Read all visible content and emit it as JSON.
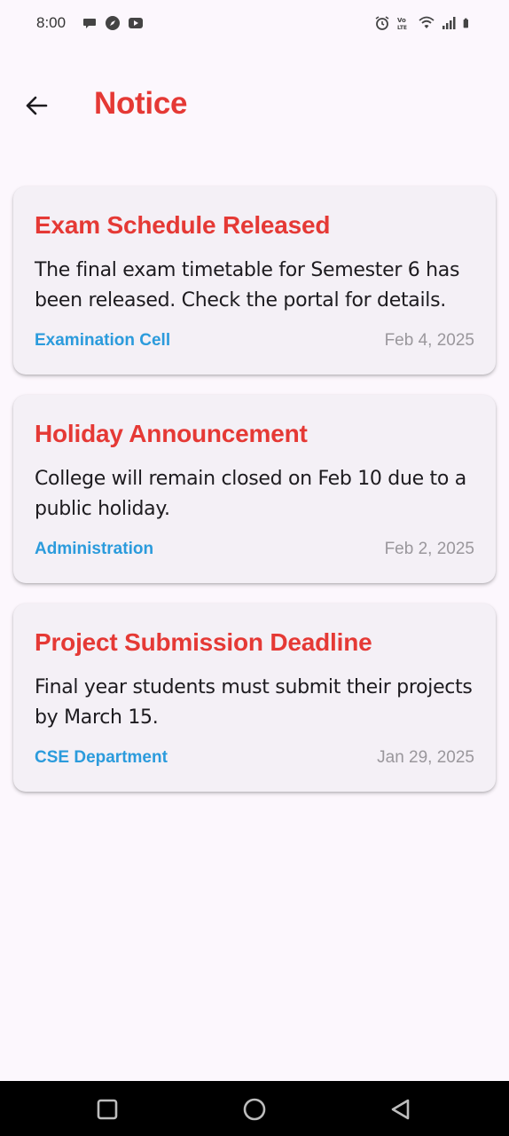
{
  "status_bar": {
    "time": "8:00",
    "left_icons": [
      "chat-bubble-icon",
      "compass-icon",
      "youtube-icon"
    ],
    "right_icons": [
      "alarm-icon",
      "volte-icon",
      "wifi-icon",
      "signal-icon",
      "battery-icon"
    ]
  },
  "app_bar": {
    "title": "Notice",
    "back_icon": "arrow-back-icon"
  },
  "notices": [
    {
      "title": "Exam Schedule Released",
      "body": "The final exam timetable for Semester 6 has been released. Check the portal for details.",
      "department": "Examination Cell",
      "date": "Feb 4, 2025"
    },
    {
      "title": "Holiday Announcement",
      "body": "College will remain closed on Feb 10 due to a public holiday.",
      "department": "Administration",
      "date": "Feb 2, 2025"
    },
    {
      "title": "Project Submission Deadline",
      "body": "Final year students must submit their projects by March 15.",
      "department": "CSE Department",
      "date": "Jan 29, 2025"
    }
  ],
  "nav_bar": {
    "buttons": [
      "recents-square-icon",
      "home-circle-icon",
      "back-triangle-icon"
    ]
  },
  "colors": {
    "accent": "#e53935",
    "department": "#2b9bdc",
    "date": "#9a979c",
    "background": "#fcf7fd",
    "card": "#f4f0f6"
  }
}
